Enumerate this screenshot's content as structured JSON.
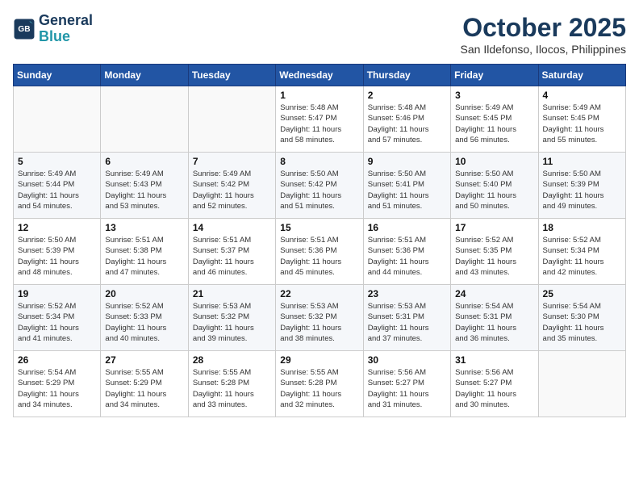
{
  "logo": {
    "line1": "General",
    "line2": "Blue"
  },
  "title": "October 2025",
  "subtitle": "San Ildefonso, Ilocos, Philippines",
  "weekdays": [
    "Sunday",
    "Monday",
    "Tuesday",
    "Wednesday",
    "Thursday",
    "Friday",
    "Saturday"
  ],
  "weeks": [
    [
      {
        "day": "",
        "info": ""
      },
      {
        "day": "",
        "info": ""
      },
      {
        "day": "",
        "info": ""
      },
      {
        "day": "1",
        "info": "Sunrise: 5:48 AM\nSunset: 5:47 PM\nDaylight: 11 hours\nand 58 minutes."
      },
      {
        "day": "2",
        "info": "Sunrise: 5:48 AM\nSunset: 5:46 PM\nDaylight: 11 hours\nand 57 minutes."
      },
      {
        "day": "3",
        "info": "Sunrise: 5:49 AM\nSunset: 5:45 PM\nDaylight: 11 hours\nand 56 minutes."
      },
      {
        "day": "4",
        "info": "Sunrise: 5:49 AM\nSunset: 5:45 PM\nDaylight: 11 hours\nand 55 minutes."
      }
    ],
    [
      {
        "day": "5",
        "info": "Sunrise: 5:49 AM\nSunset: 5:44 PM\nDaylight: 11 hours\nand 54 minutes."
      },
      {
        "day": "6",
        "info": "Sunrise: 5:49 AM\nSunset: 5:43 PM\nDaylight: 11 hours\nand 53 minutes."
      },
      {
        "day": "7",
        "info": "Sunrise: 5:49 AM\nSunset: 5:42 PM\nDaylight: 11 hours\nand 52 minutes."
      },
      {
        "day": "8",
        "info": "Sunrise: 5:50 AM\nSunset: 5:42 PM\nDaylight: 11 hours\nand 51 minutes."
      },
      {
        "day": "9",
        "info": "Sunrise: 5:50 AM\nSunset: 5:41 PM\nDaylight: 11 hours\nand 51 minutes."
      },
      {
        "day": "10",
        "info": "Sunrise: 5:50 AM\nSunset: 5:40 PM\nDaylight: 11 hours\nand 50 minutes."
      },
      {
        "day": "11",
        "info": "Sunrise: 5:50 AM\nSunset: 5:39 PM\nDaylight: 11 hours\nand 49 minutes."
      }
    ],
    [
      {
        "day": "12",
        "info": "Sunrise: 5:50 AM\nSunset: 5:39 PM\nDaylight: 11 hours\nand 48 minutes."
      },
      {
        "day": "13",
        "info": "Sunrise: 5:51 AM\nSunset: 5:38 PM\nDaylight: 11 hours\nand 47 minutes."
      },
      {
        "day": "14",
        "info": "Sunrise: 5:51 AM\nSunset: 5:37 PM\nDaylight: 11 hours\nand 46 minutes."
      },
      {
        "day": "15",
        "info": "Sunrise: 5:51 AM\nSunset: 5:36 PM\nDaylight: 11 hours\nand 45 minutes."
      },
      {
        "day": "16",
        "info": "Sunrise: 5:51 AM\nSunset: 5:36 PM\nDaylight: 11 hours\nand 44 minutes."
      },
      {
        "day": "17",
        "info": "Sunrise: 5:52 AM\nSunset: 5:35 PM\nDaylight: 11 hours\nand 43 minutes."
      },
      {
        "day": "18",
        "info": "Sunrise: 5:52 AM\nSunset: 5:34 PM\nDaylight: 11 hours\nand 42 minutes."
      }
    ],
    [
      {
        "day": "19",
        "info": "Sunrise: 5:52 AM\nSunset: 5:34 PM\nDaylight: 11 hours\nand 41 minutes."
      },
      {
        "day": "20",
        "info": "Sunrise: 5:52 AM\nSunset: 5:33 PM\nDaylight: 11 hours\nand 40 minutes."
      },
      {
        "day": "21",
        "info": "Sunrise: 5:53 AM\nSunset: 5:32 PM\nDaylight: 11 hours\nand 39 minutes."
      },
      {
        "day": "22",
        "info": "Sunrise: 5:53 AM\nSunset: 5:32 PM\nDaylight: 11 hours\nand 38 minutes."
      },
      {
        "day": "23",
        "info": "Sunrise: 5:53 AM\nSunset: 5:31 PM\nDaylight: 11 hours\nand 37 minutes."
      },
      {
        "day": "24",
        "info": "Sunrise: 5:54 AM\nSunset: 5:31 PM\nDaylight: 11 hours\nand 36 minutes."
      },
      {
        "day": "25",
        "info": "Sunrise: 5:54 AM\nSunset: 5:30 PM\nDaylight: 11 hours\nand 35 minutes."
      }
    ],
    [
      {
        "day": "26",
        "info": "Sunrise: 5:54 AM\nSunset: 5:29 PM\nDaylight: 11 hours\nand 34 minutes."
      },
      {
        "day": "27",
        "info": "Sunrise: 5:55 AM\nSunset: 5:29 PM\nDaylight: 11 hours\nand 34 minutes."
      },
      {
        "day": "28",
        "info": "Sunrise: 5:55 AM\nSunset: 5:28 PM\nDaylight: 11 hours\nand 33 minutes."
      },
      {
        "day": "29",
        "info": "Sunrise: 5:55 AM\nSunset: 5:28 PM\nDaylight: 11 hours\nand 32 minutes."
      },
      {
        "day": "30",
        "info": "Sunrise: 5:56 AM\nSunset: 5:27 PM\nDaylight: 11 hours\nand 31 minutes."
      },
      {
        "day": "31",
        "info": "Sunrise: 5:56 AM\nSunset: 5:27 PM\nDaylight: 11 hours\nand 30 minutes."
      },
      {
        "day": "",
        "info": ""
      }
    ]
  ]
}
